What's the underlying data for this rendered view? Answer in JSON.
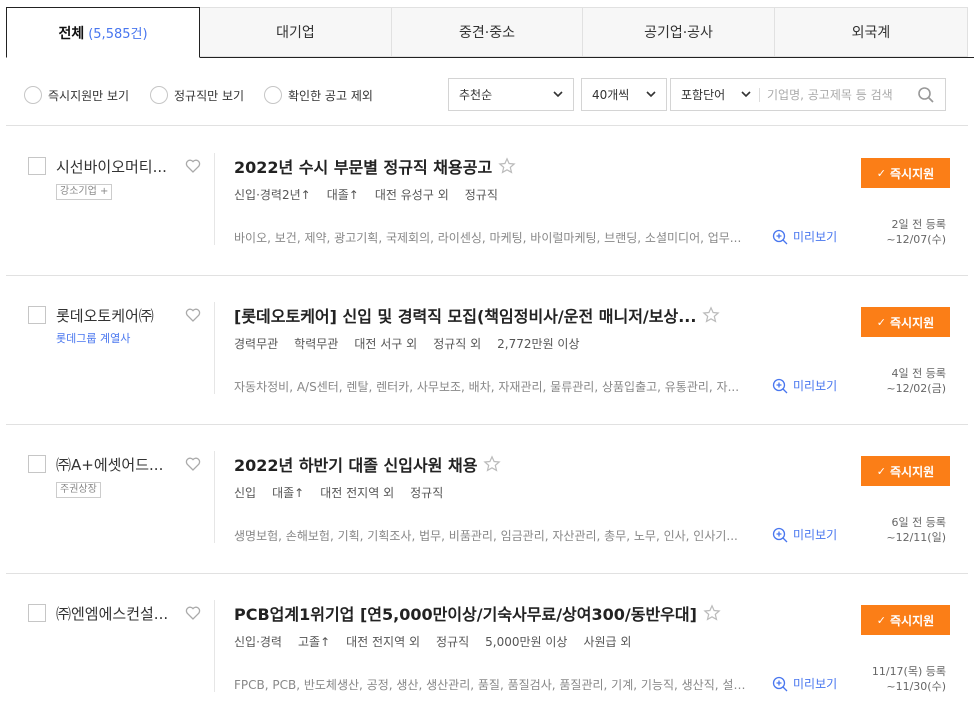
{
  "tabs": [
    {
      "label": "전체",
      "count": "(5,585건)"
    },
    {
      "label": "대기업"
    },
    {
      "label": "중견·중소"
    },
    {
      "label": "공기업·공사"
    },
    {
      "label": "외국계"
    }
  ],
  "filters": {
    "radios": [
      "즉시지원만 보기",
      "정규직만 보기",
      "확인한 공고 제외"
    ],
    "sort": "추천순",
    "per_page": "40개씩",
    "keyword_mode": "포함단어",
    "search_placeholder": "기업명, 공고제목 등 검색"
  },
  "apply_label": "즉시지원",
  "preview_label": "미리보기",
  "jobs": [
    {
      "company": "시선바이오머티...",
      "badge": "강소기업 +",
      "title": "2022년 수시 부문별 정규직 채용공고",
      "conditions": [
        "신입·경력2년↑",
        "대졸↑",
        "대전 유성구 외",
        "정규직"
      ],
      "tags": "바이오, 보건, 제약, 광고기획, 국제회의, 라이센싱, 마케팅, 바이럴마케팅, 브랜딩, 소셜미디어, 업무...",
      "posted": "2일 전 등록",
      "deadline": "~12/07(수)"
    },
    {
      "company": "롯데오토케어㈜",
      "badge": "롯데그룹 계열사",
      "title": "[롯데오토케어] 신입 및 경력직 모집(책임정비사/운전 매니저/보상...",
      "conditions": [
        "경력무관",
        "학력무관",
        "대전 서구 외",
        "정규직 외",
        "2,772만원 이상"
      ],
      "tags": "자동차정비, A/S센터, 렌탈, 렌터카, 사무보조, 배차, 자재관리, 물류관리, 상품입출고, 유통관리, 자...",
      "posted": "4일 전 등록",
      "deadline": "~12/02(금)"
    },
    {
      "company": "㈜A+에셋어드...",
      "badge": "주권상장",
      "title": "2022년 하반기 대졸 신입사원 채용",
      "conditions": [
        "신입",
        "대졸↑",
        "대전 전지역 외",
        "정규직"
      ],
      "tags": "생명보험, 손해보험, 기획, 기획조사, 법무, 비품관리, 임금관리, 자산관리, 총무, 노무, 인사, 인사기...",
      "posted": "6일 전 등록",
      "deadline": "~12/11(일)"
    },
    {
      "company": "㈜엔엠에스컨설...",
      "badge": "",
      "title": "PCB업계1위기업 [연5,000만이상/기숙사무료/상여300/동반우대]",
      "conditions": [
        "신입·경력",
        "고졸↑",
        "대전 전지역 외",
        "정규직",
        "5,000만원 이상",
        "사원급 외"
      ],
      "tags": "FPCB, PCB, 반도체생산, 공정, 생산, 생산관리, 품질, 품질검사, 품질관리, 기계, 기능직, 생산직, 설비,...",
      "posted": "11/17(목) 등록",
      "deadline": "~11/30(수)"
    }
  ]
}
